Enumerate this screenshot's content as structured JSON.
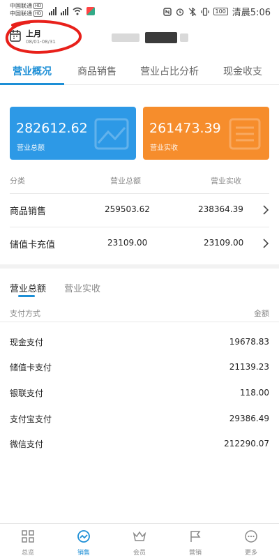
{
  "status_bar": {
    "carrier_line1": "中国联通",
    "carrier_line2": "中国联通",
    "hd_badge": "HD",
    "network": "4G",
    "battery": "100",
    "time": "清晨5:06",
    "icons": [
      "nfc-icon",
      "alarm-icon",
      "bluetooth-off-icon",
      "vibrate-icon",
      "battery-icon"
    ]
  },
  "header": {
    "period_title": "上月",
    "period_range": "08/01-08/31",
    "annotation_color": "#e8201a"
  },
  "tabs": [
    {
      "label": "营业概况",
      "active": true
    },
    {
      "label": "商品销售",
      "active": false
    },
    {
      "label": "营业占比分析",
      "active": false
    },
    {
      "label": "现金收支",
      "active": false
    }
  ],
  "summary": {
    "total_card": {
      "value": "282612.62",
      "label": "营业总额",
      "color": "#2d99e6"
    },
    "received_card": {
      "value": "261473.39",
      "label": "营业实收",
      "color": "#f68d2c"
    },
    "columns": [
      "分类",
      "营业总额",
      "营业实收"
    ],
    "rows": [
      {
        "name": "商品销售",
        "total": "259503.62",
        "received": "238364.39"
      },
      {
        "name": "储值卡充值",
        "total": "23109.00",
        "received": "23109.00"
      }
    ]
  },
  "payment": {
    "tabs": [
      {
        "label": "营业总额",
        "active": true
      },
      {
        "label": "营业实收",
        "active": false
      }
    ],
    "columns": [
      "支付方式",
      "金额"
    ],
    "rows": [
      {
        "method": "现金支付",
        "amount": "19678.83"
      },
      {
        "method": "储值卡支付",
        "amount": "21139.23"
      },
      {
        "method": "银联支付",
        "amount": "118.00"
      },
      {
        "method": "支付宝支付",
        "amount": "29386.49"
      },
      {
        "method": "微信支付",
        "amount": "212290.07"
      }
    ]
  },
  "bottom_nav": [
    {
      "label": "总览",
      "icon": "grid-icon",
      "active": false
    },
    {
      "label": "销售",
      "icon": "sales-trend-icon",
      "active": true
    },
    {
      "label": "会员",
      "icon": "crown-icon",
      "active": false
    },
    {
      "label": "营销",
      "icon": "flag-icon",
      "active": false
    },
    {
      "label": "更多",
      "icon": "more-dots-icon",
      "active": false
    }
  ],
  "colors": {
    "accent": "#1d8fd6",
    "total_card": "#2d99e6",
    "received_card": "#f68d2c"
  }
}
